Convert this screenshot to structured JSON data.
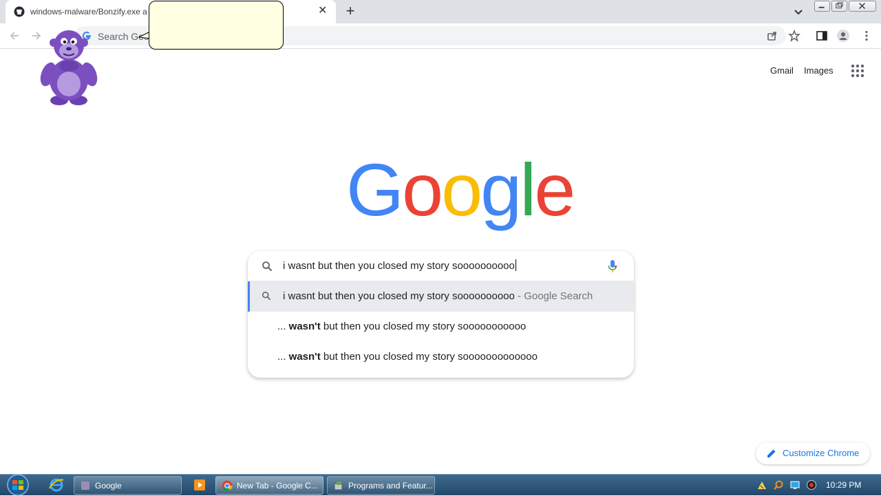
{
  "browser": {
    "tab_title": "windows-malware/Bonzify.exe a",
    "new_tab_symbol": "+",
    "close_symbol": "✕",
    "omnibox_placeholder": "Search Goo"
  },
  "page": {
    "gmail": "Gmail",
    "images": "Images",
    "logo": [
      "G",
      "o",
      "o",
      "g",
      "l",
      "e"
    ],
    "logo_colors": [
      "#4285f4",
      "#ea4335",
      "#fbbc05",
      "#4285f4",
      "#34a853",
      "#ea4335"
    ],
    "search_query": "i wasnt but then you closed my story soooooooooo",
    "suggestions": [
      {
        "text": "i wasnt but then you closed my story soooooooooo",
        "suffix": " - Google Search"
      },
      {
        "prefix": "... ",
        "bold": "wasn't",
        "rest": " but then you closed my story sooooooooooo"
      },
      {
        "prefix": "... ",
        "bold": "wasn't",
        "rest": " but then you closed my story sooooooooooooo"
      }
    ],
    "customize": "Customize Chrome"
  },
  "taskbar": {
    "buttons": [
      {
        "label": "Google"
      },
      {
        "label": "New Tab - Google C..."
      },
      {
        "label": "Programs and Featur..."
      }
    ],
    "clock": "10:29 PM"
  },
  "colors": {
    "accent": "#1a73e8",
    "bubble": "#ffffe1",
    "bonzi": "#7c4fc0"
  }
}
